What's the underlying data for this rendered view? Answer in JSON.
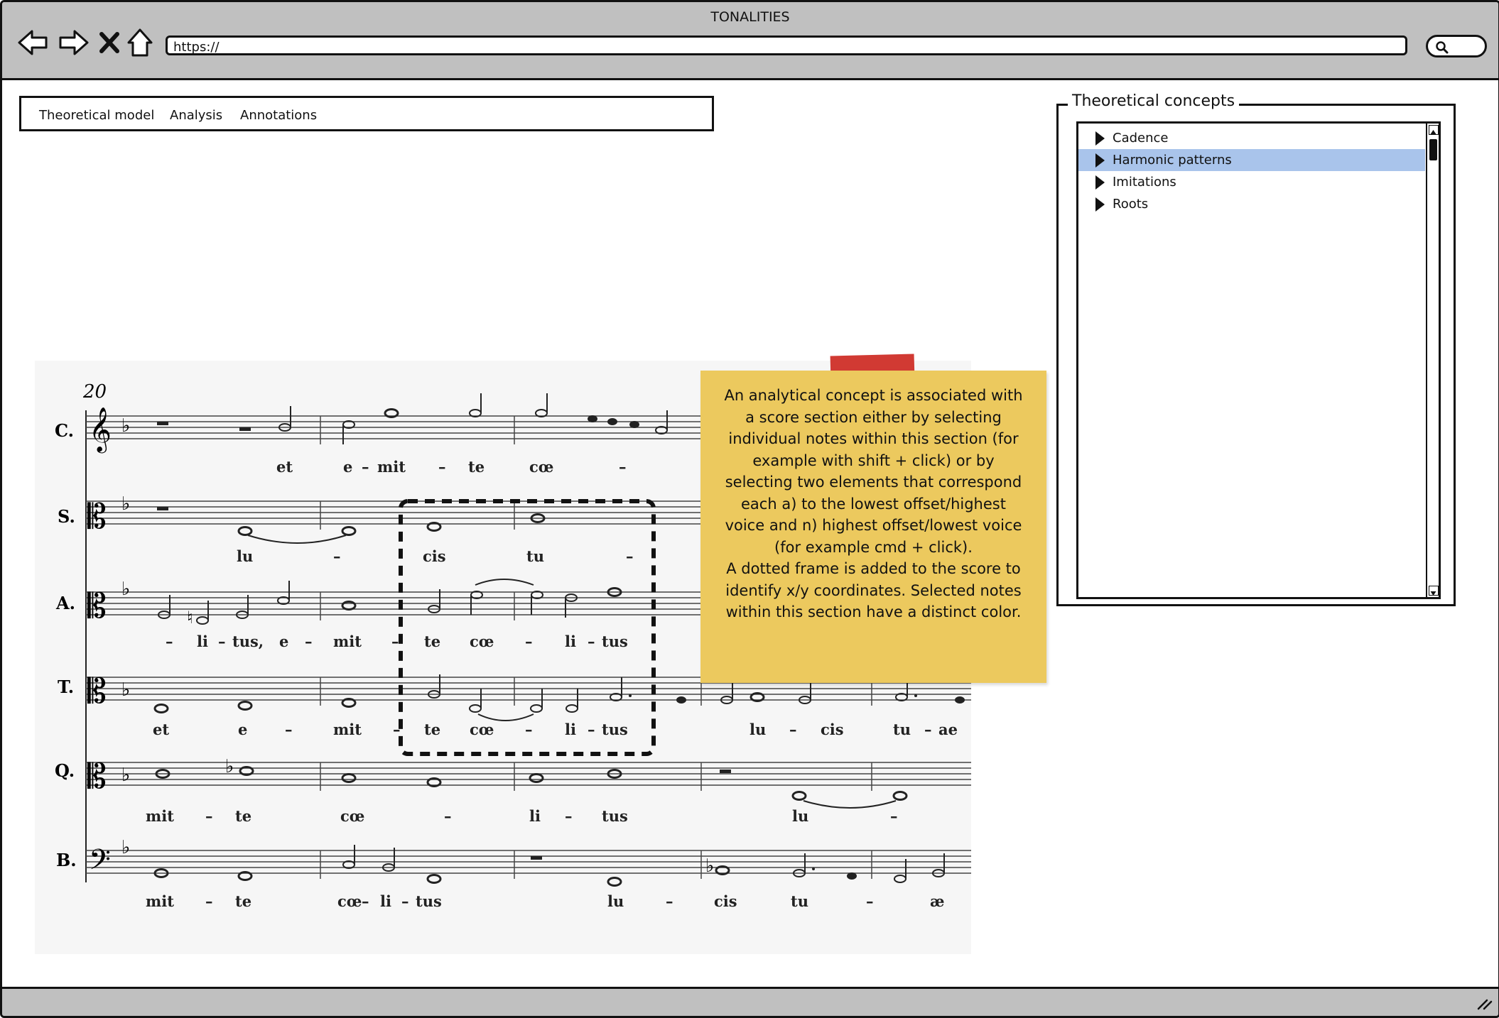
{
  "window": {
    "title": "TONALITIES"
  },
  "navigation": {
    "back_icon": "back-arrow-icon",
    "forward_icon": "forward-arrow-icon",
    "stop_icon": "close-icon",
    "home_icon": "home-icon",
    "url": "https://",
    "search_icon": "search-icon"
  },
  "menubar": {
    "items": [
      {
        "label": "Theoretical model"
      },
      {
        "label": "Analysis"
      },
      {
        "label": "Annotations"
      }
    ]
  },
  "concepts_panel": {
    "title": "Theoretical concepts",
    "items": [
      {
        "label": "Cadence",
        "selected": false
      },
      {
        "label": "Harmonic patterns",
        "selected": true
      },
      {
        "label": "Imitations",
        "selected": false
      },
      {
        "label": "Roots",
        "selected": false
      }
    ],
    "selected_color": "#a9c4eb"
  },
  "score": {
    "measure_number": "20",
    "voices": [
      {
        "label": "C.",
        "clef": "treble",
        "lyrics": [
          "et",
          "e",
          "–",
          "mit",
          "–",
          "te",
          "cœ",
          "–"
        ]
      },
      {
        "label": "S.",
        "clef": "alto",
        "lyrics": [
          "lu",
          "–",
          "cis",
          "tu",
          "–"
        ]
      },
      {
        "label": "A.",
        "clef": "alto",
        "lyrics": [
          "–",
          "li",
          "–",
          "tus,",
          "e",
          "–",
          "mit",
          "–",
          "te",
          "cœ",
          "–",
          "li",
          "–",
          "tus"
        ]
      },
      {
        "label": "T.",
        "clef": "alto",
        "lyrics": [
          "et",
          "e",
          "–",
          "mit",
          "–",
          "te",
          "cœ",
          "–",
          "li",
          "–",
          "tus",
          "lu",
          "–",
          "cis",
          "tu",
          "–",
          "ae"
        ]
      },
      {
        "label": "Q.",
        "clef": "alto",
        "lyrics": [
          "mit",
          "–",
          "te",
          "cœ",
          "–",
          "li",
          "–",
          "tus",
          "lu",
          "–"
        ]
      },
      {
        "label": "B.",
        "clef": "bass",
        "lyrics": [
          "mit",
          "–",
          "te",
          "cœ",
          "–",
          "li",
          "–",
          "tus",
          "lu",
          "–",
          "cis",
          "tu",
          "–",
          "æ"
        ]
      }
    ]
  },
  "sticky_note": {
    "color": "#ecc95e",
    "tape_color": "#d13a33",
    "lines": [
      "An analytical concept is associated with",
      "a score section either by selecting",
      "individual notes within this section (for",
      "example with shift + click) or by",
      "selecting two elements that correspond",
      "each a) to the lowest offset/highest",
      "voice and n) highest offset/lowest voice",
      "(for example cmd + click).",
      "A dotted frame is added to the score to",
      "identify x/y coordinates.  Selected notes",
      "within this section have a distinct color."
    ]
  }
}
